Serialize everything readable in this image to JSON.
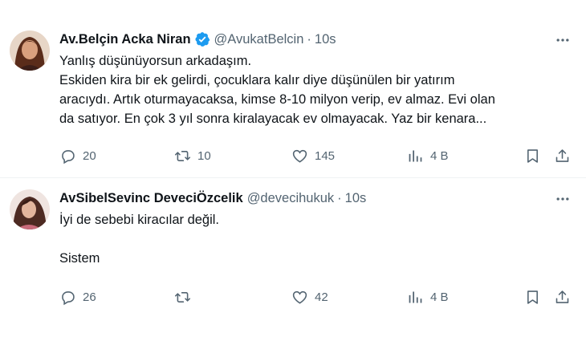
{
  "tweets": [
    {
      "author": {
        "name": "Av.Belçin Acka Niran",
        "handle": "@AvukatBelcin",
        "verified": true,
        "avatar_icon": "avatar-photo-woman"
      },
      "dot": "·",
      "time": "10s",
      "text_lines": [
        "Yanlış düşünüyorsun arkadaşım.",
        "Eskiden kira bir ek gelirdi, çocuklara kalır diye düşünülen bir yatırım",
        "aracıydı. Artık oturmayacaksa, kimse 8-10 milyon verip, ev almaz. Evi olan",
        "da satıyor. En çok 3 yıl sonra kiralayacak ev olmayacak. Yaz bir kenara..."
      ],
      "stats": {
        "replies": "20",
        "retweets": "10",
        "likes": "145",
        "views": "4 B"
      }
    },
    {
      "author": {
        "name": "AvSibelSevinc DeveciÖzcelik",
        "handle": "@devecihukuk",
        "verified": false,
        "avatar_icon": "avatar-photo-woman"
      },
      "dot": "·",
      "time": "10s",
      "text_lines": [
        "İyi de sebebi kiracılar değil.",
        "Sistem"
      ],
      "stats": {
        "replies": "26",
        "retweets": "",
        "likes": "42",
        "views": "4 B"
      }
    }
  ],
  "colors": {
    "text_primary": "#0f1419",
    "text_secondary": "#536471",
    "verified_blue": "#1d9bf0",
    "divider": "#eff3f4"
  }
}
